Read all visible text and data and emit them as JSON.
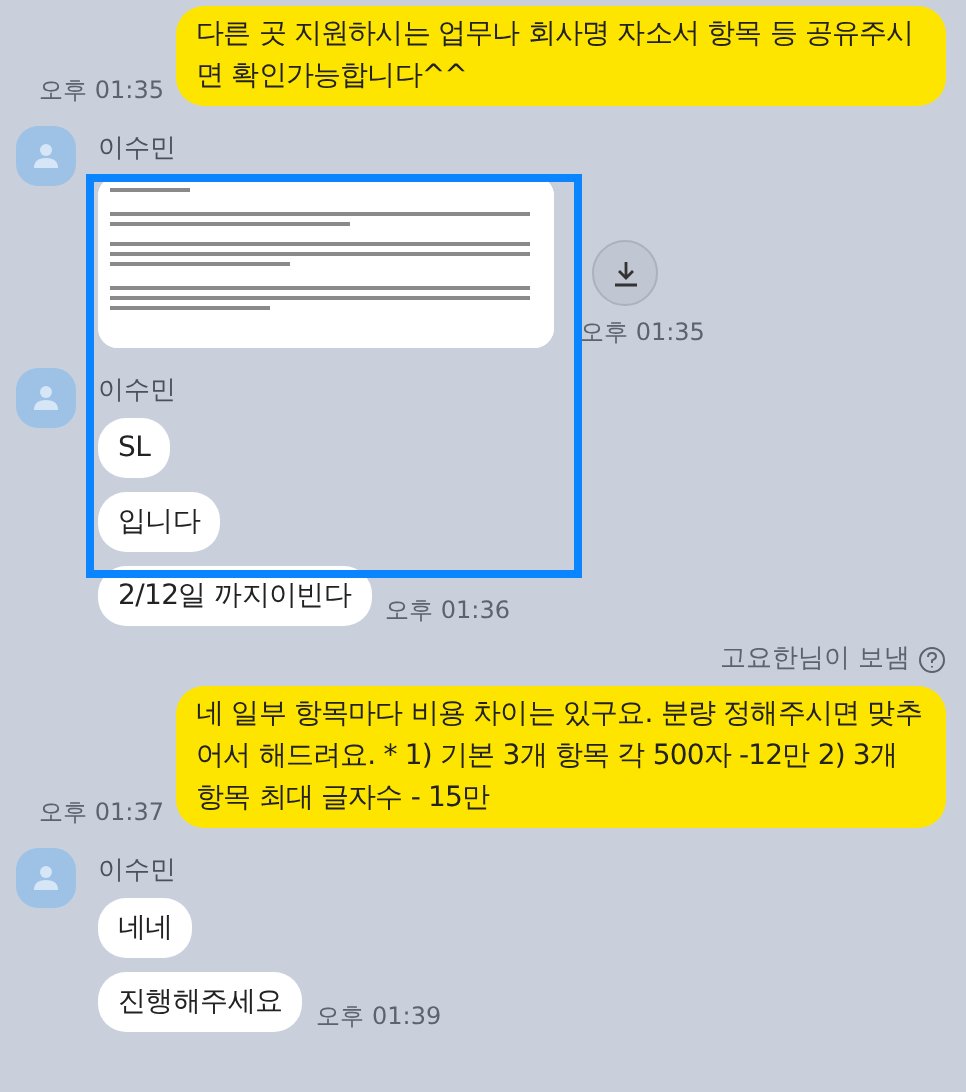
{
  "messages": [
    {
      "kind": "outgoing",
      "text": "다른 곳 지원하시는 업무나 회사명 자소서 항목 등 공유주시면 확인가능합니다^^",
      "time": "오후 01:35"
    },
    {
      "sender": "이수민",
      "time": "오후 01:35"
    },
    {
      "kind": "incoming",
      "sender": "이수민",
      "text": "SL"
    },
    {
      "kind": "incoming",
      "text": "입니다"
    },
    {
      "kind": "incoming",
      "text": "2/12일 까지이빈다",
      "time": "오후 01:36"
    },
    {
      "kind": "sent_label",
      "text": "고요한님이 보냄"
    },
    {
      "kind": "outgoing",
      "text": "네 일부 항목마다 비용 차이는 있구요. 분량 정해주시면 맞추어서 해드려요. * 1) 기본 3개 항목 각 500자 -12만 2) 3개 항목 최대 글자수 - 15만",
      "time": "오후 01:37"
    },
    {
      "kind": "incoming",
      "sender": "이수민",
      "text": "네네"
    },
    {
      "kind": "incoming",
      "text": "진행해주세요",
      "time": "오후 01:39"
    }
  ]
}
